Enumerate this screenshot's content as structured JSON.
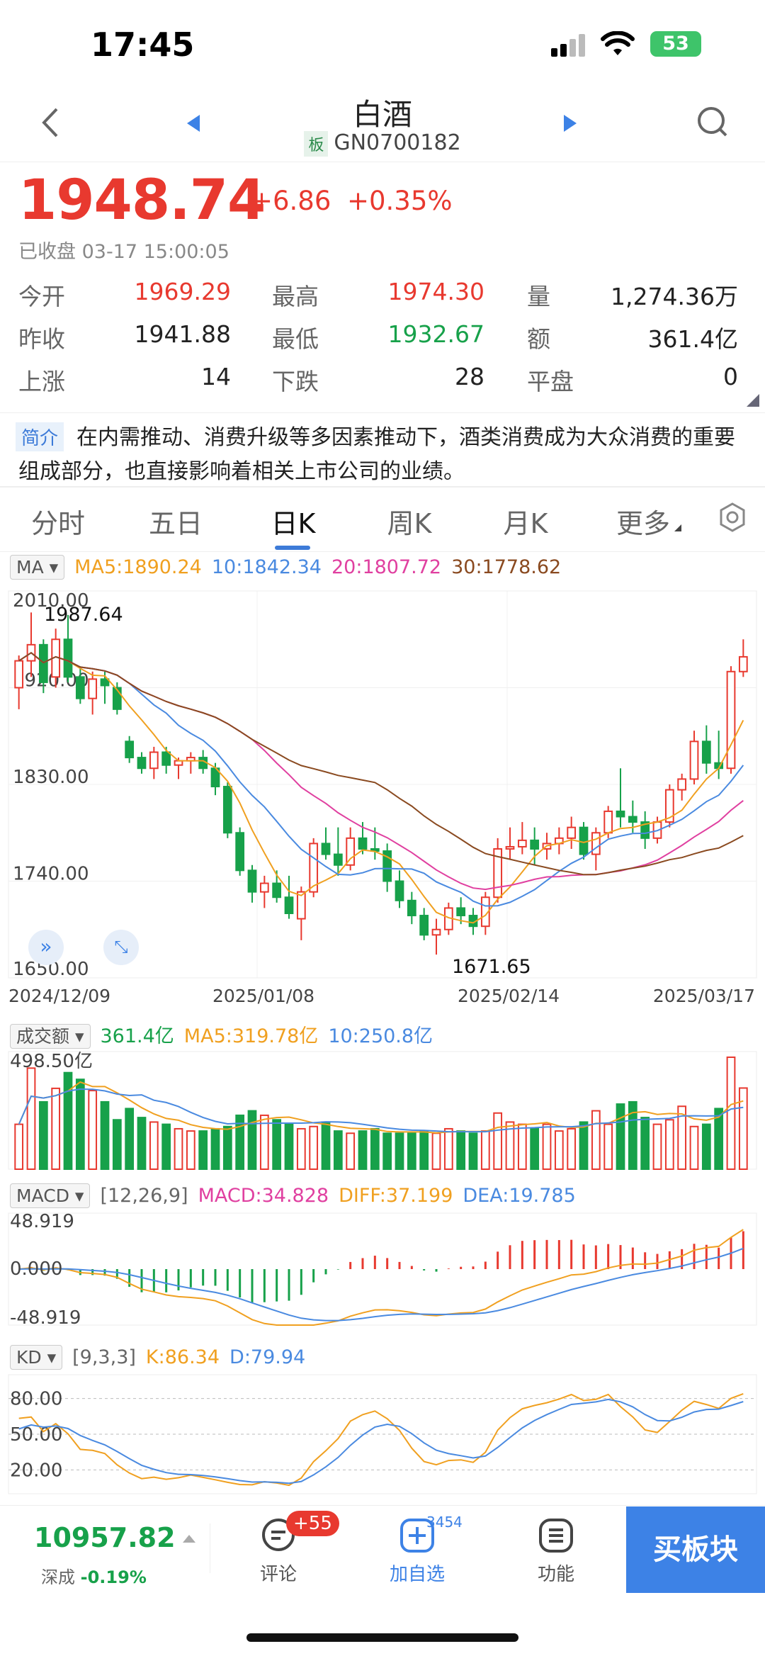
{
  "status": {
    "time": "17:45",
    "battery": "53"
  },
  "header": {
    "title": "白酒",
    "badge": "板",
    "code": "GN0700182"
  },
  "quote": {
    "price": "1948.74",
    "change": "+6.86",
    "change_pct": "+0.35%",
    "status_line": "已收盘 03-17 15:00:05",
    "rows": [
      [
        {
          "label": "今开",
          "value": "1969.29",
          "tone": "up"
        },
        {
          "label": "最高",
          "value": "1974.30",
          "tone": "up"
        },
        {
          "label": "量",
          "value": "1,274.36万",
          "tone": "neutral"
        }
      ],
      [
        {
          "label": "昨收",
          "value": "1941.88",
          "tone": "neutral"
        },
        {
          "label": "最低",
          "value": "1932.67",
          "tone": "down"
        },
        {
          "label": "额",
          "value": "361.4亿",
          "tone": "neutral"
        }
      ],
      [
        {
          "label": "上涨",
          "value": "14",
          "tone": "neutral"
        },
        {
          "label": "下跌",
          "value": "28",
          "tone": "neutral"
        },
        {
          "label": "平盘",
          "value": "0",
          "tone": "neutral"
        }
      ]
    ]
  },
  "intro": {
    "tag": "简介",
    "text": "在内需推动、消费升级等多因素推动下，酒类消费成为大众消费的重要组成部分，也直接影响着相关上市公司的业绩。"
  },
  "tabs": [
    "分时",
    "五日",
    "日K",
    "周K",
    "月K",
    "更多"
  ],
  "indicators": {
    "ma": {
      "selector": "MA",
      "items": [
        {
          "text": "MA5:1890.24",
          "color": "#f0a020"
        },
        {
          "text": "10:1842.34",
          "color": "#4a8ae0"
        },
        {
          "text": "20:1807.72",
          "color": "#e040a0"
        },
        {
          "text": "30:1778.62",
          "color": "#8a4a20"
        }
      ]
    },
    "vol": {
      "selector": "成交额",
      "items": [
        {
          "text": "361.4亿",
          "color": "#17a14a"
        },
        {
          "text": "MA5:319.78亿",
          "color": "#f0a020"
        },
        {
          "text": "10:250.8亿",
          "color": "#4a8ae0"
        }
      ]
    },
    "macd": {
      "selector": "MACD",
      "items": [
        {
          "text": "[12,26,9]",
          "color": "#666"
        },
        {
          "text": "MACD:34.828",
          "color": "#e040a0"
        },
        {
          "text": "DIFF:37.199",
          "color": "#f0a020"
        },
        {
          "text": "DEA:19.785",
          "color": "#4a8ae0"
        }
      ]
    },
    "kd": {
      "selector": "KD",
      "items": [
        {
          "text": "[9,3,3]",
          "color": "#666"
        },
        {
          "text": "K:86.34",
          "color": "#f0a020"
        },
        {
          "text": "D:79.94",
          "color": "#4a8ae0"
        }
      ]
    }
  },
  "colors": {
    "up": "#e8392f",
    "down": "#17a14a",
    "ma5": "#f0a020",
    "ma10": "#4a8ae0",
    "ma20": "#e040a0",
    "ma30": "#8a4a20",
    "accent": "#3d82e6"
  },
  "chart_data": [
    {
      "type": "candlestick",
      "y_ticks": [
        "2010.00",
        "1920.00",
        "1830.00",
        "1740.00",
        "1650.00"
      ],
      "ylim": [
        1650,
        2010
      ],
      "x_labels": [
        "2024/12/09",
        "2025/01/08",
        "2025/02/14",
        "2025/03/17"
      ],
      "annotations": [
        {
          "text": "1987.64"
        },
        {
          "text": "1671.65"
        }
      ],
      "series": [
        {
          "name": "MA5"
        },
        {
          "name": "MA10"
        },
        {
          "name": "MA20"
        },
        {
          "name": "MA30"
        }
      ],
      "ohlc": [
        [
          1920,
          1950,
          1900,
          1945
        ],
        [
          1945,
          1990,
          1930,
          1960
        ],
        [
          1960,
          1965,
          1915,
          1925
        ],
        [
          1930,
          1975,
          1920,
          1965
        ],
        [
          1965,
          1987.64,
          1925,
          1930
        ],
        [
          1930,
          1940,
          1905,
          1910
        ],
        [
          1910,
          1935,
          1895,
          1928
        ],
        [
          1928,
          1935,
          1905,
          1922
        ],
        [
          1920,
          1925,
          1895,
          1900
        ],
        [
          1870,
          1875,
          1850,
          1855
        ],
        [
          1855,
          1860,
          1840,
          1845
        ],
        [
          1845,
          1865,
          1835,
          1860
        ],
        [
          1860,
          1865,
          1840,
          1848
        ],
        [
          1848,
          1855,
          1835,
          1852
        ],
        [
          1852,
          1860,
          1840,
          1855
        ],
        [
          1855,
          1862,
          1840,
          1845
        ],
        [
          1845,
          1850,
          1820,
          1828
        ],
        [
          1828,
          1832,
          1780,
          1785
        ],
        [
          1785,
          1790,
          1745,
          1750
        ],
        [
          1750,
          1755,
          1720,
          1730
        ],
        [
          1730,
          1745,
          1715,
          1738
        ],
        [
          1738,
          1750,
          1720,
          1725
        ],
        [
          1725,
          1745,
          1705,
          1710
        ],
        [
          1705,
          1735,
          1685,
          1730
        ],
        [
          1730,
          1780,
          1725,
          1775
        ],
        [
          1775,
          1790,
          1760,
          1765
        ],
        [
          1765,
          1790,
          1745,
          1755
        ],
        [
          1755,
          1790,
          1750,
          1780
        ],
        [
          1780,
          1795,
          1765,
          1770
        ],
        [
          1770,
          1790,
          1760,
          1768
        ],
        [
          1768,
          1775,
          1730,
          1740
        ],
        [
          1740,
          1750,
          1715,
          1722
        ],
        [
          1722,
          1730,
          1700,
          1708
        ],
        [
          1708,
          1715,
          1685,
          1690
        ],
        [
          1690,
          1705,
          1671.65,
          1695
        ],
        [
          1695,
          1720,
          1690,
          1715
        ],
        [
          1715,
          1725,
          1700,
          1708
        ],
        [
          1708,
          1715,
          1690,
          1698
        ],
        [
          1698,
          1730,
          1690,
          1725
        ],
        [
          1725,
          1780,
          1720,
          1770
        ],
        [
          1770,
          1790,
          1760,
          1772
        ],
        [
          1772,
          1795,
          1765,
          1778
        ],
        [
          1778,
          1790,
          1755,
          1770
        ],
        [
          1770,
          1785,
          1760,
          1775
        ],
        [
          1775,
          1790,
          1765,
          1780
        ],
        [
          1780,
          1800,
          1770,
          1790
        ],
        [
          1790,
          1795,
          1760,
          1765
        ],
        [
          1765,
          1790,
          1750,
          1785
        ],
        [
          1785,
          1810,
          1780,
          1805
        ],
        [
          1805,
          1845,
          1790,
          1800
        ],
        [
          1800,
          1815,
          1785,
          1795
        ],
        [
          1795,
          1805,
          1770,
          1780
        ],
        [
          1780,
          1800,
          1775,
          1795
        ],
        [
          1795,
          1830,
          1790,
          1825
        ],
        [
          1825,
          1840,
          1815,
          1835
        ],
        [
          1835,
          1880,
          1830,
          1870
        ],
        [
          1870,
          1885,
          1840,
          1850
        ],
        [
          1850,
          1880,
          1835,
          1845
        ],
        [
          1845,
          1940,
          1840,
          1935
        ],
        [
          1935,
          1965,
          1930,
          1948.74
        ]
      ]
    },
    {
      "type": "bar",
      "y_ticks": [
        "498.50亿"
      ],
      "volumes": [
        200,
        450,
        300,
        360,
        430,
        400,
        350,
        300,
        220,
        270,
        230,
        210,
        200,
        180,
        170,
        170,
        180,
        190,
        240,
        260,
        240,
        220,
        200,
        180,
        190,
        210,
        170,
        160,
        170,
        180,
        160,
        160,
        160,
        170,
        160,
        180,
        170,
        160,
        170,
        250,
        210,
        200,
        180,
        200,
        170,
        180,
        210,
        260,
        200,
        290,
        300,
        230,
        200,
        220,
        280,
        190,
        200,
        270,
        498.5,
        361.4
      ]
    },
    {
      "type": "bar",
      "y_ticks": [
        "48.919",
        "0.000",
        "-48.919"
      ],
      "ylim": [
        -48.919,
        48.919
      ]
    },
    {
      "type": "line",
      "y_ticks": [
        "80.00",
        "50.00",
        "20.00"
      ],
      "ylim": [
        0,
        100
      ]
    }
  ],
  "bottom": {
    "index_value": "10957.82",
    "index_name": "深成",
    "index_change": "-0.19%",
    "comment_label": "评论",
    "comment_badge": "+55",
    "watch_label": "加自选",
    "watch_count": "3454",
    "func_label": "功能",
    "buy_label": "买板块"
  }
}
